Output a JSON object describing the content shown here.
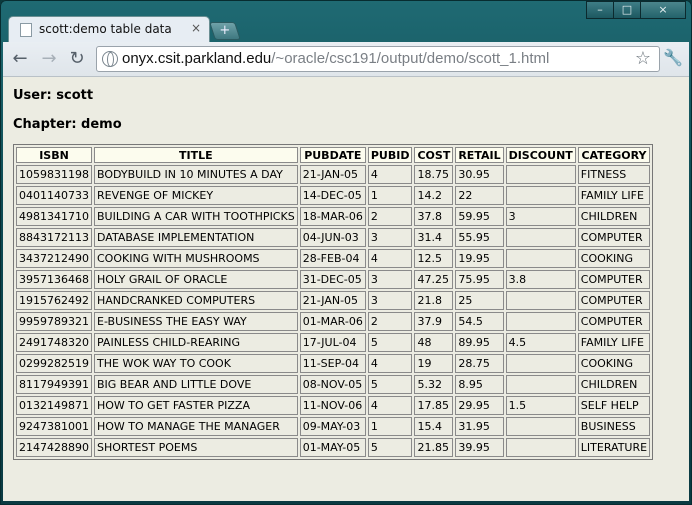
{
  "tab": {
    "title": "scott:demo table data",
    "close": "×",
    "new_tab": "+"
  },
  "window_controls": {
    "minimize": "–",
    "maximize": "□",
    "close": "×"
  },
  "toolbar": {
    "back": "←",
    "forward": "→",
    "reload": "↻",
    "url_host": "onyx.csit.parkland.edu",
    "url_path": "/~oracle/csc191/output/demo/scott_1.html",
    "star": "☆",
    "wrench": "🔧"
  },
  "page": {
    "user_label": "User: scott",
    "chapter_label": "Chapter: demo"
  },
  "table": {
    "headers": [
      "ISBN",
      "TITLE",
      "PUBDATE",
      "PUBID",
      "COST",
      "RETAIL",
      "DISCOUNT",
      "CATEGORY"
    ],
    "rows": [
      [
        "1059831198",
        "BODYBUILD IN 10 MINUTES A DAY",
        "21-JAN-05",
        "4",
        "18.75",
        "30.95",
        "",
        "FITNESS"
      ],
      [
        "0401140733",
        "REVENGE OF MICKEY",
        "14-DEC-05",
        "1",
        "14.2",
        "22",
        "",
        "FAMILY LIFE"
      ],
      [
        "4981341710",
        "BUILDING A CAR WITH TOOTHPICKS",
        "18-MAR-06",
        "2",
        "37.8",
        "59.95",
        "3",
        "CHILDREN"
      ],
      [
        "8843172113",
        "DATABASE IMPLEMENTATION",
        "04-JUN-03",
        "3",
        "31.4",
        "55.95",
        "",
        "COMPUTER"
      ],
      [
        "3437212490",
        "COOKING WITH MUSHROOMS",
        "28-FEB-04",
        "4",
        "12.5",
        "19.95",
        "",
        "COOKING"
      ],
      [
        "3957136468",
        "HOLY GRAIL OF ORACLE",
        "31-DEC-05",
        "3",
        "47.25",
        "75.95",
        "3.8",
        "COMPUTER"
      ],
      [
        "1915762492",
        "HANDCRANKED COMPUTERS",
        "21-JAN-05",
        "3",
        "21.8",
        "25",
        "",
        "COMPUTER"
      ],
      [
        "9959789321",
        "E-BUSINESS THE EASY WAY",
        "01-MAR-06",
        "2",
        "37.9",
        "54.5",
        "",
        "COMPUTER"
      ],
      [
        "2491748320",
        "PAINLESS CHILD-REARING",
        "17-JUL-04",
        "5",
        "48",
        "89.95",
        "4.5",
        "FAMILY LIFE"
      ],
      [
        "0299282519",
        "THE WOK WAY TO COOK",
        "11-SEP-04",
        "4",
        "19",
        "28.75",
        "",
        "COOKING"
      ],
      [
        "8117949391",
        "BIG BEAR AND LITTLE DOVE",
        "08-NOV-05",
        "5",
        "5.32",
        "8.95",
        "",
        "CHILDREN"
      ],
      [
        "0132149871",
        "HOW TO GET FASTER PIZZA",
        "11-NOV-06",
        "4",
        "17.85",
        "29.95",
        "1.5",
        "SELF HELP"
      ],
      [
        "9247381001",
        "HOW TO MANAGE THE MANAGER",
        "09-MAY-03",
        "1",
        "15.4",
        "31.95",
        "",
        "BUSINESS"
      ],
      [
        "2147428890",
        "SHORTEST POEMS",
        "01-MAY-05",
        "5",
        "21.85",
        "39.95",
        "",
        "LITERATURE"
      ]
    ]
  }
}
